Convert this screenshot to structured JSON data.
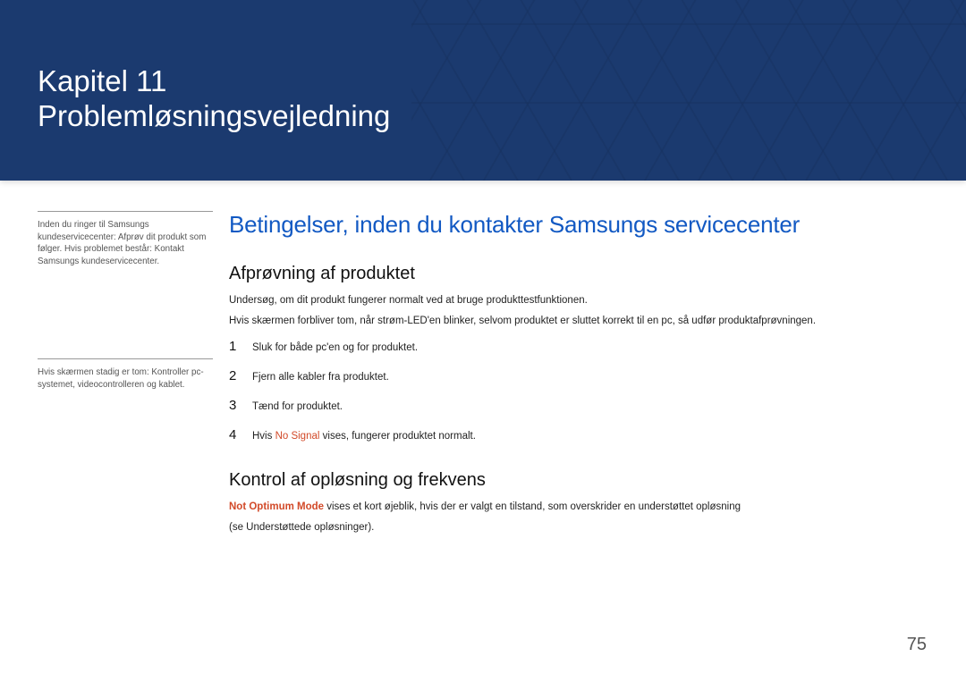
{
  "banner": {
    "chapter_line": "Kapitel 11",
    "title_line": "Problemløsningsvejledning"
  },
  "sidebar": {
    "note1": "Inden du ringer til Samsungs kundeservicecenter: Afprøv dit produkt som følger. Hvis problemet består: Kontakt Samsungs kundeservicecenter.",
    "note2": "Hvis skærmen stadig er tom: Kontroller pc-systemet, videocontrolleren og kablet."
  },
  "main": {
    "section_title": "Betingelser, inden du kontakter Samsungs servicecenter",
    "sub1": {
      "title": "Afprøvning af produktet",
      "para1": "Undersøg, om dit produkt fungerer normalt ved at bruge produkttestfunktionen.",
      "para2": "Hvis skærmen forbliver tom, når strøm-LED'en blinker, selvom produktet er sluttet korrekt til en pc, så udfør produktafprøvningen.",
      "steps": [
        {
          "num": "1",
          "text": "Sluk for både pc'en og for produktet."
        },
        {
          "num": "2",
          "text": "Fjern alle kabler fra produktet."
        },
        {
          "num": "3",
          "text": "Tænd for produktet."
        },
        {
          "num": "4",
          "prefix": "Hvis ",
          "highlight": "No Signal",
          "suffix": " vises, fungerer produktet normalt."
        }
      ]
    },
    "sub2": {
      "title": "Kontrol af opløsning og frekvens",
      "para_highlight": "Not Optimum Mode",
      "para_rest": " vises et kort øjeblik, hvis der er valgt en tilstand, som overskrider en understøttet opløsning",
      "para2": "(se Understøttede opløsninger)."
    }
  },
  "page_number": "75"
}
